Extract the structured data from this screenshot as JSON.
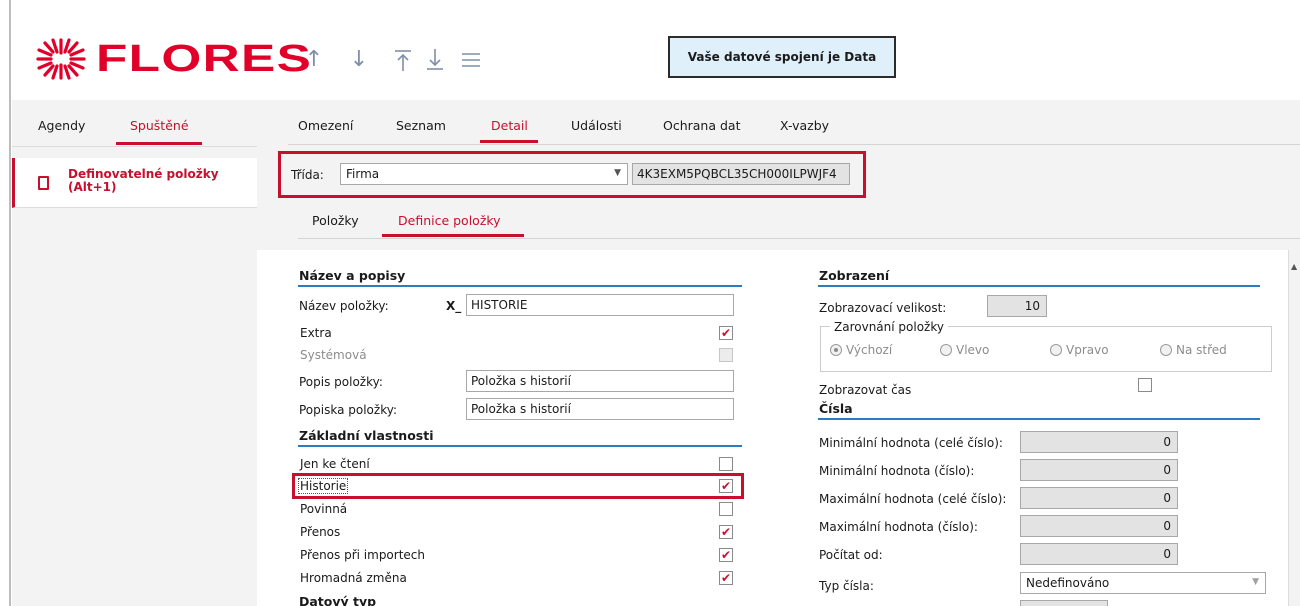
{
  "header": {
    "brand": "FLORES",
    "toolbar_icons": [
      "arrow-up-icon",
      "arrow-down-icon",
      "move-to-top-icon",
      "move-to-bottom-icon",
      "menu-icon"
    ],
    "connection_label": "Vaše datové spojení je Data"
  },
  "sidebar": {
    "tabs": [
      {
        "label": "Agendy"
      },
      {
        "label": "Spuštěné"
      }
    ],
    "item_label": "Definovatelné položky (Alt+1)"
  },
  "main": {
    "tabs": [
      {
        "label": "Omezení"
      },
      {
        "label": "Seznam"
      },
      {
        "label": "Detail"
      },
      {
        "label": "Události"
      },
      {
        "label": "Ochrana dat"
      },
      {
        "label": "X-vazby"
      }
    ],
    "trida_label": "Třída:",
    "trida_value": "Firma",
    "trida_code": "4K3EXM5PQBCL35CH000ILPWJF4",
    "subtabs": [
      {
        "label": "Položky"
      },
      {
        "label": "Definice položky"
      }
    ]
  },
  "form": {
    "names_section": "Název a popisy",
    "nazev_label": "Název položky:",
    "nazev_prefix": "X_",
    "nazev_value": "HISTORIE",
    "extra_label": "Extra",
    "systemova_label": "Systémová",
    "popis_label": "Popis položky:",
    "popis_value": "Položka s historií",
    "popiska_label": "Popiska položky:",
    "popiska_value": "Položka s historií",
    "props_section": "Základní vlastnosti",
    "props": [
      {
        "label": "Jen ke čtení",
        "checked": false
      },
      {
        "label": "Historie",
        "checked": true
      },
      {
        "label": "Povinná",
        "checked": false
      },
      {
        "label": "Přenos",
        "checked": true
      },
      {
        "label": "Přenos při importech",
        "checked": true
      },
      {
        "label": "Hromadná změna",
        "checked": true
      }
    ],
    "datatype_section": "Datový typ",
    "display_section": "Zobrazení",
    "display_size_label": "Zobrazovací velikost:",
    "display_size_value": "10",
    "align_legend": "Zarovnání položky",
    "align_options": [
      {
        "label": "Výchozí",
        "checked": true
      },
      {
        "label": "Vlevo",
        "checked": false
      },
      {
        "label": "Vpravo",
        "checked": false
      },
      {
        "label": "Na střed",
        "checked": false
      }
    ],
    "show_time_label": "Zobrazovat čas",
    "numbers_section": "Čísla",
    "number_fields": [
      {
        "label": "Minimální hodnota (celé číslo):",
        "value": "0"
      },
      {
        "label": "Minimální hodnota (číslo):",
        "value": "0"
      },
      {
        "label": "Maximální hodnota (celé číslo):",
        "value": "0"
      },
      {
        "label": "Maximální hodnota (číslo):",
        "value": "0"
      },
      {
        "label": "Počítat od:",
        "value": "0"
      }
    ],
    "number_type_label": "Typ čísla:",
    "number_type_value": "Nedefinováno"
  },
  "colors": {
    "accent": "#c8102e",
    "section_line": "#2f7bbf",
    "connection_bg": "#dff0fb"
  }
}
